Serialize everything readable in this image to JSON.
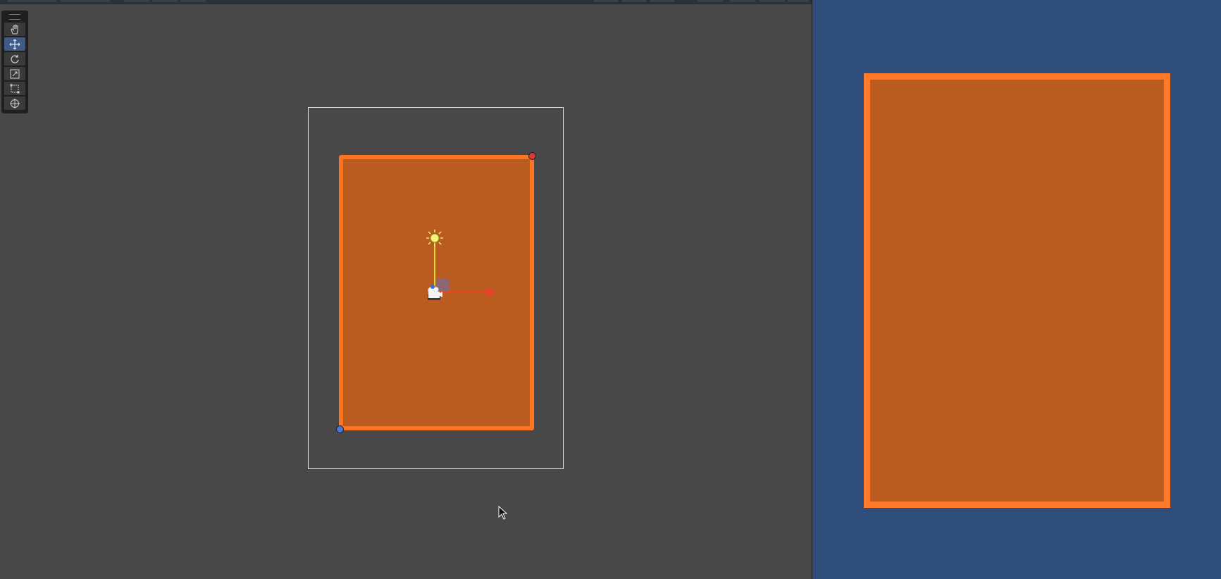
{
  "scene_view": {
    "background": "#484848",
    "tools": [
      {
        "name": "hand-tool",
        "glyph": "✋",
        "active": false
      },
      {
        "name": "move-tool",
        "glyph": "✥",
        "active": true
      },
      {
        "name": "rotate-tool",
        "glyph": "⟳",
        "active": false
      },
      {
        "name": "scale-tool",
        "glyph": "⤢",
        "active": false
      },
      {
        "name": "rect-tool",
        "glyph": "⬚",
        "active": false
      },
      {
        "name": "transform-tool",
        "glyph": "⊕",
        "active": false
      }
    ],
    "camera_frame_color": "#e8e8e8",
    "sprite_fill": "#ba5b20",
    "sprite_border": "#ff7420",
    "gizmo": {
      "x_axis_color": "#e8442a",
      "y_axis_color": "#d8d83a",
      "light_icon": "sun-icon",
      "camera_icon": "camera-icon"
    }
  },
  "game_view": {
    "background": "#2f4d7a",
    "sprite_fill": "#ba5b20",
    "sprite_border": "#ff7a2a"
  }
}
